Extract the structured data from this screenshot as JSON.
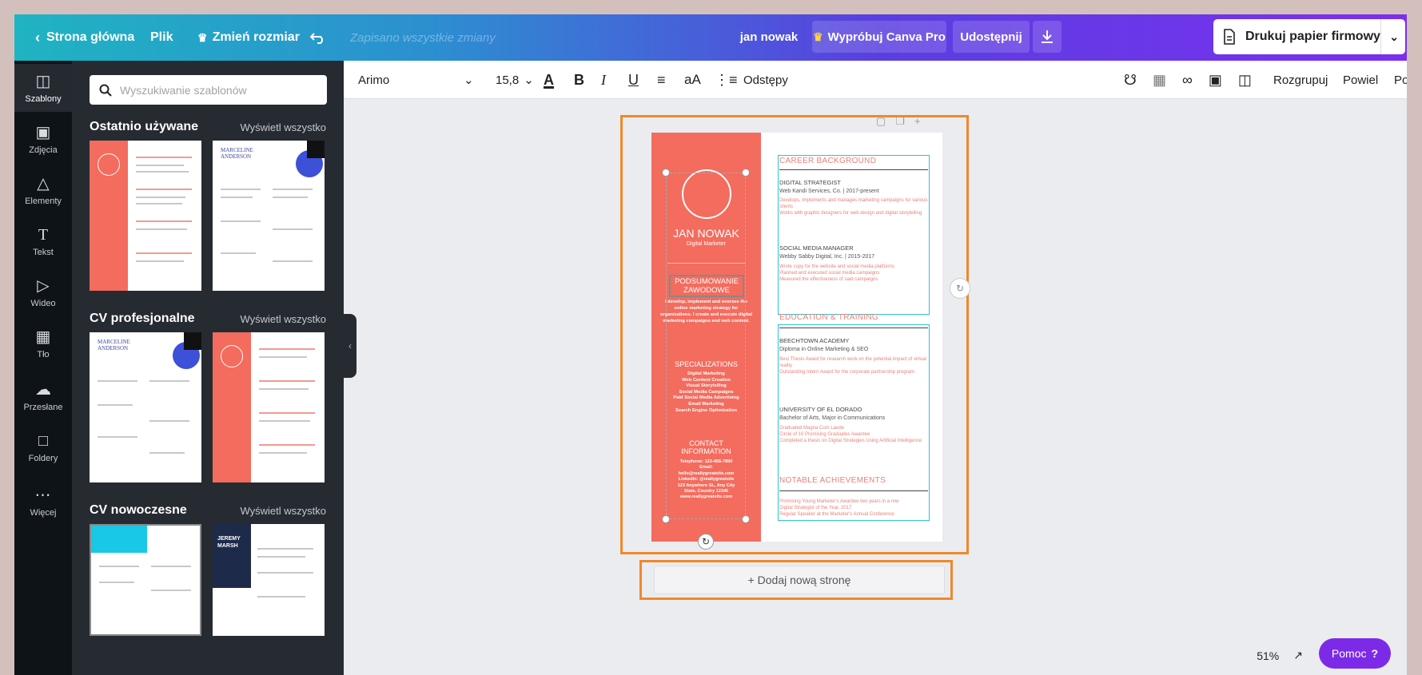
{
  "topbar": {
    "home": "Strona główna",
    "file": "Plik",
    "resize": "Zmień rozmiar",
    "saved_status": "Zapisano wszystkie zmiany",
    "user_name": "jan nowak",
    "try_pro": "Wypróbuj Canva Pro",
    "share": "Udostępnij",
    "print_label": "Drukuj papier firmowy"
  },
  "rail": [
    {
      "label": "Szablony",
      "icon": "templates-icon"
    },
    {
      "label": "Zdjęcia",
      "icon": "photos-icon"
    },
    {
      "label": "Elementy",
      "icon": "elements-icon"
    },
    {
      "label": "Tekst",
      "icon": "text-icon"
    },
    {
      "label": "Wideo",
      "icon": "video-icon"
    },
    {
      "label": "Tło",
      "icon": "background-icon"
    },
    {
      "label": "Przesłane",
      "icon": "uploads-icon"
    },
    {
      "label": "Foldery",
      "icon": "folders-icon"
    },
    {
      "label": "Więcej",
      "icon": "more-icon"
    }
  ],
  "panel": {
    "search_placeholder": "Wyszukiwanie szablonów",
    "sections": [
      {
        "title": "Ostatnio używane",
        "link": "Wyświetl wszystko"
      },
      {
        "title": "CV profesjonalne",
        "link": "Wyświetl wszystko"
      },
      {
        "title": "CV nowoczesne",
        "link": "Wyświetl wszystko"
      }
    ],
    "thumb_texts": {
      "marceline": "MARCELINE ANDERSON",
      "jeremy": "JEREMY MARSH"
    }
  },
  "toolbar": {
    "font": "Arimo",
    "font_size": "15,8",
    "spacing": "Odstępy",
    "case": "aA",
    "ungroup": "Rozgrupuj",
    "duplicate": "Powiel",
    "position": "Pozycja"
  },
  "cv": {
    "name": "JAN NOWAK",
    "role": "Digital Marketer",
    "summary_title": "PODSUMOWANIE ZAWODOWE",
    "summary_text": "I develop, implement and oversee the online marketing strategy for organizations. I create and execute digital marketing campaigns and web content.",
    "specializations_title": "SPECIALIZATIONS",
    "specializations": [
      "Digital Marketing",
      "Web Content Creation",
      "Visual Storytelling",
      "Social Media Campaigns",
      "Paid Social Media Advertising",
      "Email Marketing",
      "Search Engine Optimization"
    ],
    "contact_title": "CONTACT INFORMATION",
    "contact": [
      "Telephone: 123-456-7890",
      "Email:",
      "hello@reallygreatsite.com",
      "LinkedIn: @reallygreatsite",
      "123 Anywhere St., Any City",
      "State, Country 12345",
      "www.reallygreatsite.com"
    ],
    "career_title": "CAREER BACKGROUND",
    "job1_title": "DIGITAL STRATEGIST",
    "job1_company": "Web Kandi Services, Co. | 2017-present",
    "job1_bullets": [
      "Develops, implements and manages marketing campaigns for various clients",
      "Works with graphic designers for web design and digital storytelling"
    ],
    "job2_title": "SOCIAL MEDIA MANAGER",
    "job2_company": "Webby Sabby Digital, Inc. | 2015-2017",
    "job2_bullets": [
      "Wrote copy for the website and social media platforms",
      "Planned and executed social media campaigns",
      "Measured the effectiveness of said campaigns"
    ],
    "education_title": "EDUCATION & TRAINING",
    "edu1_title": "BEECHTOWN ACADEMY",
    "edu1_sub": "Diploma in Online Marketing & SEO",
    "edu1_bullets": [
      "Best Thesis Award for research work on the potential impact of virtual reality",
      "Outstanding Intern Award for the corporate partnership program"
    ],
    "edu2_title": "UNIVERSITY OF EL DORADO",
    "edu2_sub": "Bachelor of Arts, Major in Communications",
    "edu2_bullets": [
      "Graduated Magna Cum Laude",
      "Circle of 10 Promising Graduates Awardee",
      "Completed a thesis on Digital Strategies Using Artificial Intelligence"
    ],
    "achievements_title": "NOTABLE ACHIEVEMENTS",
    "achievements": [
      "Promising Young Marketer's Awardee two years in a row",
      "Digital Strategist of the Year, 2017",
      "Regular Speaker at the Marketer's Annual Conference"
    ]
  },
  "canvas": {
    "add_page": "+ Dodaj nową stronę",
    "zoom": "51%",
    "help": "Pomoc",
    "help_icon": "?"
  },
  "colors": {
    "accent_orange": "#f0882a",
    "cv_red": "#f36c5e",
    "help_purple": "#7d2ae8",
    "selection_teal": "#2ec4d0"
  }
}
